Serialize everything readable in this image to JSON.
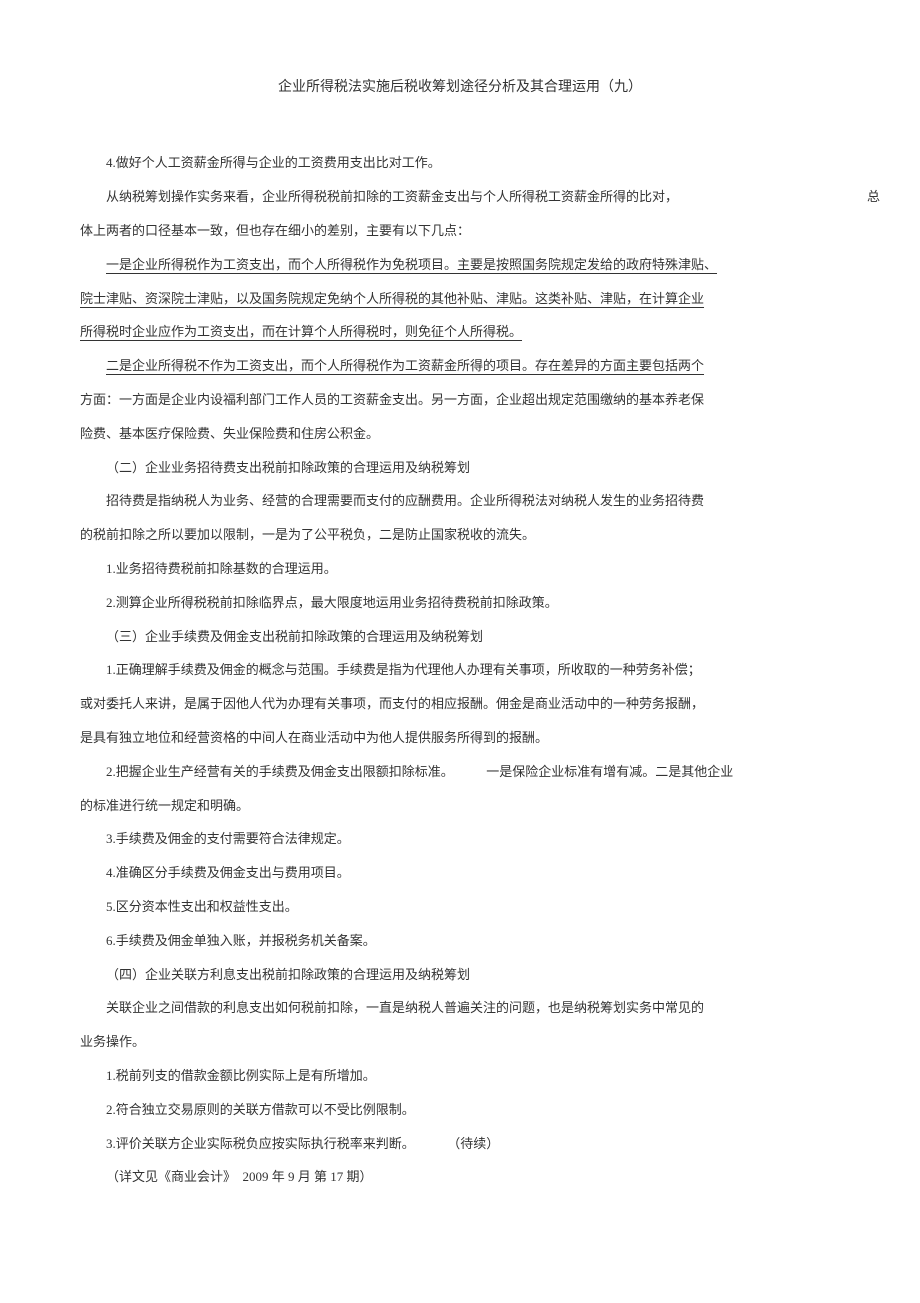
{
  "title": "企业所得税法实施后税收筹划途径分析及其合理运用（九）",
  "p1": "4.做好个人工资薪金所得与企业的工资费用支出比对工作。",
  "p2a": "从纳税筹划操作实务来看，企业所得税税前扣除的工资薪金支出与个人所得税工资薪金所得的比对，",
  "p2right": "总",
  "p2b": "体上两者的口径基本一致，但也存在细小的差别，主要有以下几点：",
  "p3a": "一是企业所得税作为工资支出，而个人所得税作为免税项目。主要是按照国务院规定发给的政府特殊津贴、",
  "p3b": "院士津贴、资深院士津贴，以及国务院规定免纳个人所得税的其他补贴、津贴。这类补贴、津贴，在计算企业",
  "p3c": "所得税时企业应作为工资支出，而在计算个人所得税时，则免征个人所得税。",
  "p4a": "二是企业所得税不作为工资支出，而个人所得税作为工资薪金所得的项目。存在差异的方面主要包括两个",
  "p4b": "方面：一方面是企业内设福利部门工作人员的工资薪金支出。另一方面，企业超出规定范围缴纳的基本养老保",
  "p4c": "险费、基本医疗保险费、失业保险费和住房公积金。",
  "p5": "（二）企业业务招待费支出税前扣除政策的合理运用及纳税筹划",
  "p6a": "招待费是指纳税人为业务、经营的合理需要而支付的应酬费用。企业所得税法对纳税人发生的业务招待费",
  "p6b": "的税前扣除之所以要加以限制，一是为了公平税负，二是防止国家税收的流失。",
  "p7": "1.业务招待费税前扣除基数的合理运用。",
  "p8": "2.测算企业所得税税前扣除临界点，最大限度地运用业务招待费税前扣除政策。",
  "p9": "（三）企业手续费及佣金支出税前扣除政策的合理运用及纳税筹划",
  "p10a": "1.正确理解手续费及佣金的概念与范围。手续费是指为代理他人办理有关事项，所收取的一种劳务补偿；",
  "p10b": "或对委托人来讲，是属于因他人代为办理有关事项，而支付的相应报酬。佣金是商业活动中的一种劳务报酬，",
  "p10c": "是具有独立地位和经营资格的中间人在商业活动中为他人提供服务所得到的报酬。",
  "p11a": "2.把握企业生产经营有关的手续费及佣金支出限额扣除标准。",
  "p11b": "一是保险企业标准有增有减。二是其他企业",
  "p11c": "的标准进行统一规定和明确。",
  "p12": "3.手续费及佣金的支付需要符合法律规定。",
  "p13": "4.准确区分手续费及佣金支出与费用项目。",
  "p14": "5.区分资本性支出和权益性支出。",
  "p15": "6.手续费及佣金单独入账，并报税务机关备案。",
  "p16": "（四）企业关联方利息支出税前扣除政策的合理运用及纳税筹划",
  "p17a": "关联企业之间借款的利息支出如何税前扣除，一直是纳税人普遍关注的问题，也是纳税筹划实务中常见的",
  "p17b": "业务操作。",
  "p18": "1.税前列支的借款金额比例实际上是有所增加。",
  "p19": "2.符合独立交易原则的关联方借款可以不受比例限制。",
  "p20a": "3.评价关联方企业实际税负应按实际执行税率来判断。",
  "p20b": "（待续）",
  "p21": "（详文见《商业会计》　2009 年 9 月  第 17 期）"
}
